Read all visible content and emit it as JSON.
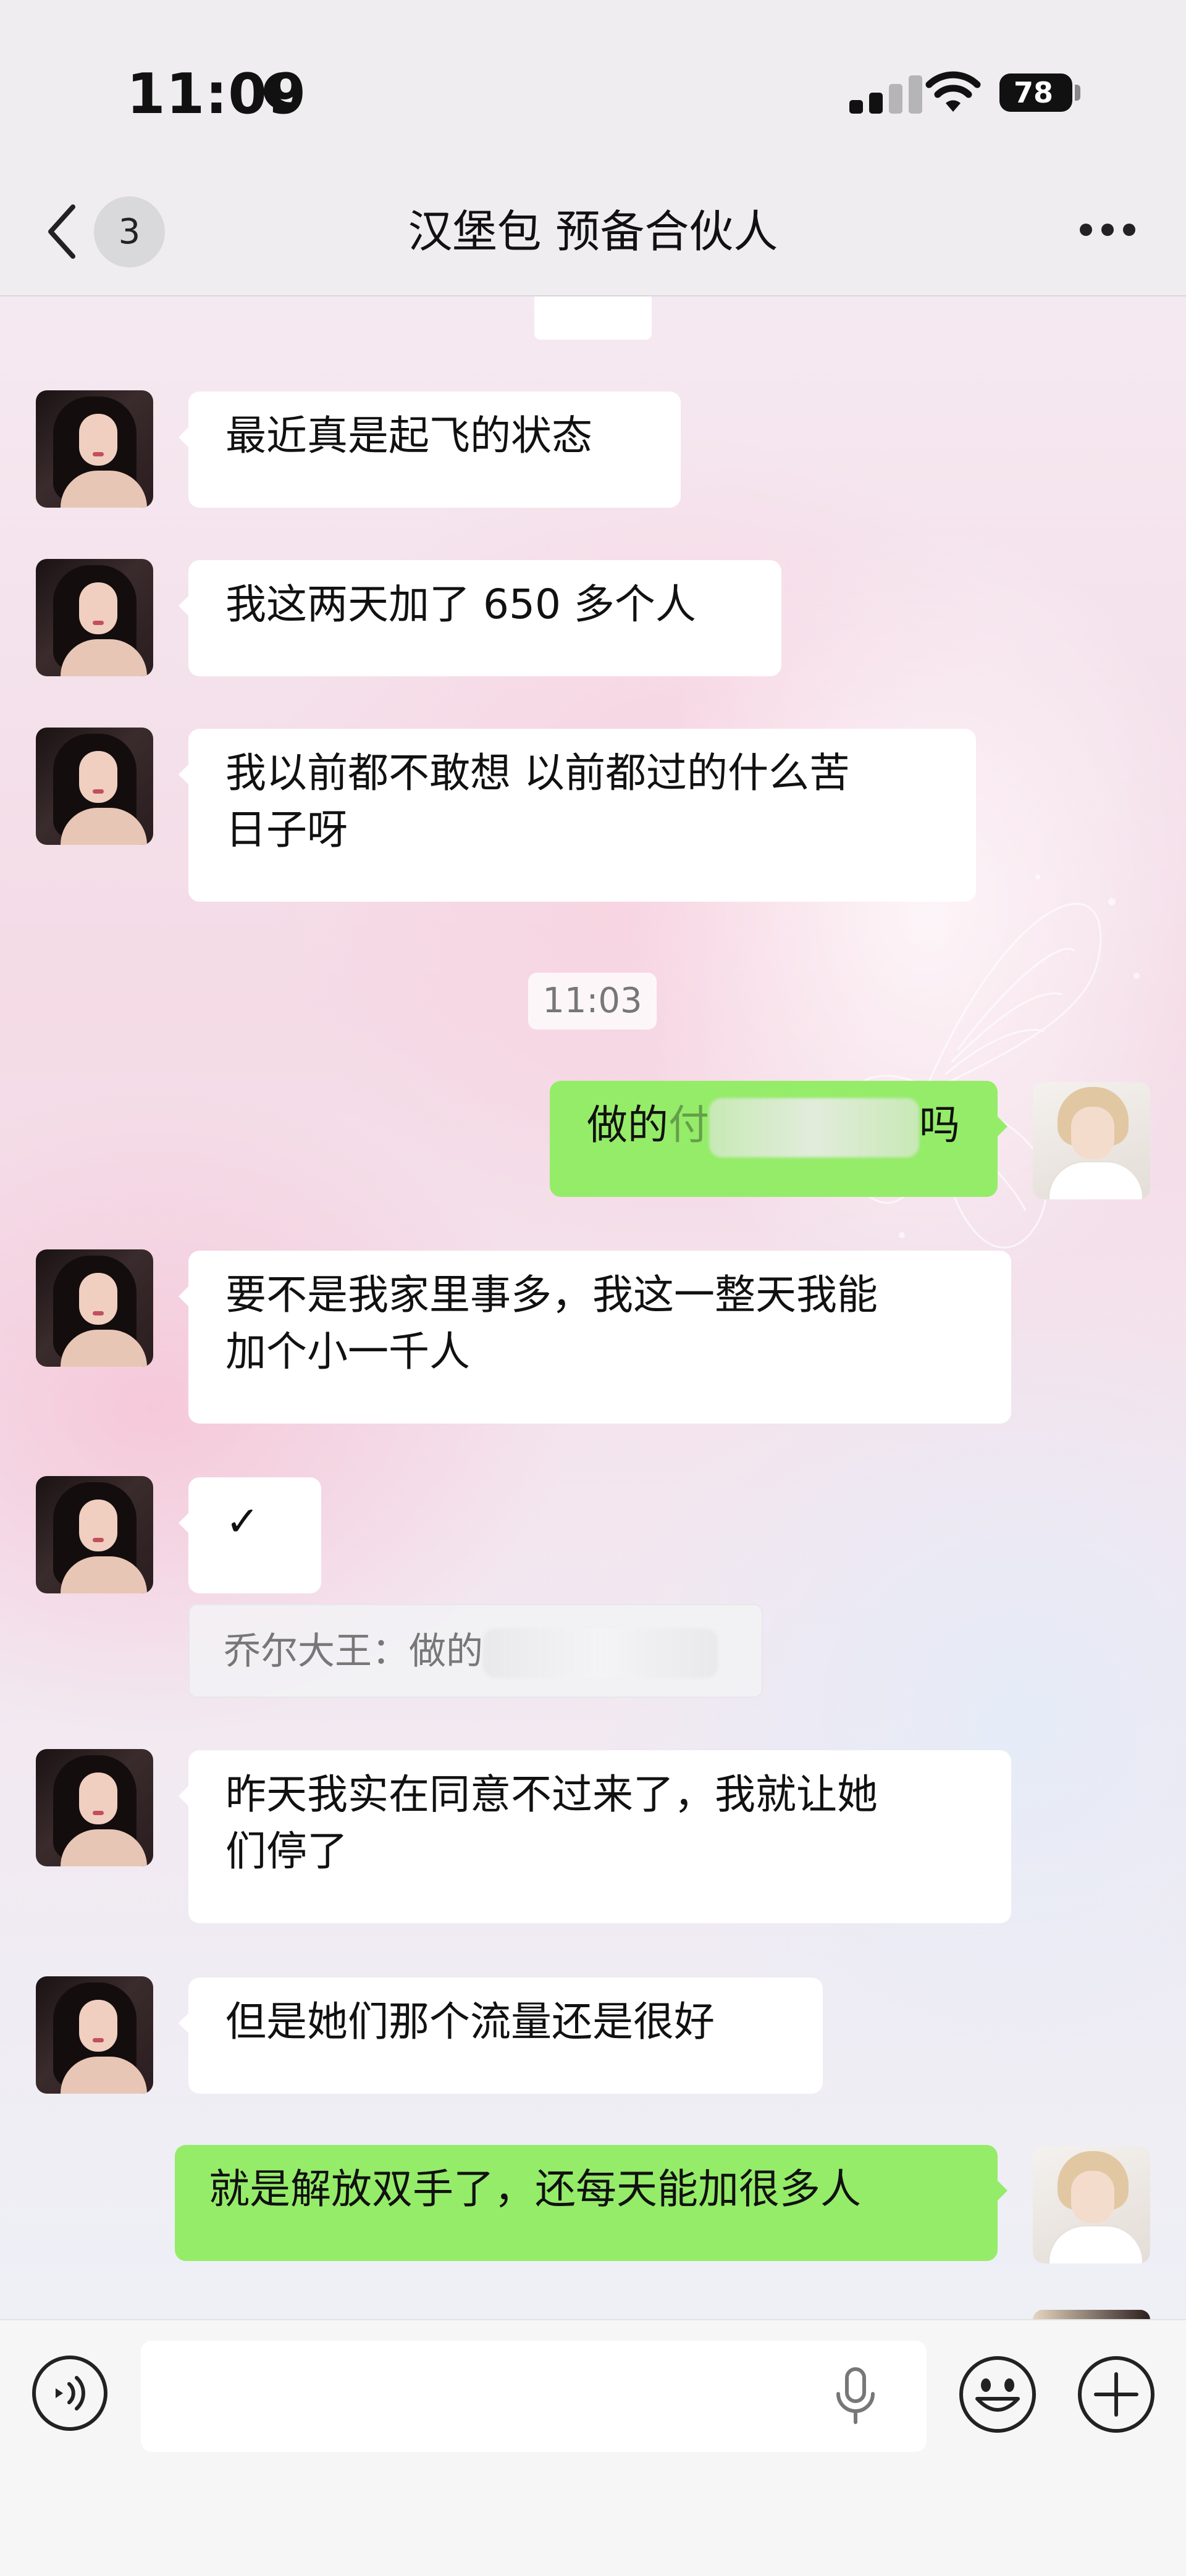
{
  "status_bar": {
    "time": "11:09",
    "battery": "78",
    "battery_level_percent": 78,
    "signal_bars_filled": 2,
    "signal_bars_total": 4
  },
  "header": {
    "unread_count": "3",
    "title": "汉堡包 预备合伙人"
  },
  "messages": [
    {
      "side": "in",
      "text": "最近真是起飞的状态"
    },
    {
      "side": "in",
      "text": "我这两天加了 650 多个人"
    },
    {
      "side": "in",
      "text": "我以前都不敢想 以前都过的什么苦\n日子呀"
    },
    {
      "type": "time",
      "text": "11:03"
    },
    {
      "side": "out",
      "text_before": "做的",
      "text_blurred_fragment": "付",
      "text_after": "吗"
    },
    {
      "side": "in",
      "text": "要不是我家里事多，我这一整天我能\n加个小一千人"
    },
    {
      "side": "in",
      "text": "✓"
    },
    {
      "type": "quote",
      "text": "乔尔大王：做的"
    },
    {
      "side": "in",
      "text": "昨天我实在同意不过来了，我就让她\n们停了"
    },
    {
      "side": "in",
      "text": "但是她们那个流量还是很好"
    },
    {
      "side": "out",
      "text": "就是解放双手了，还每天能加很多人"
    }
  ],
  "icons": {
    "back": "chevron-left-icon",
    "more": "more-dots-icon",
    "voice": "voice-mode-icon",
    "mic": "microphone-icon",
    "emoji": "emoji-icon",
    "plus": "plus-icon"
  },
  "colors": {
    "outgoing_bubble": "#95ec69",
    "incoming_bubble": "#ffffff",
    "header_bg": "#efedf0"
  }
}
